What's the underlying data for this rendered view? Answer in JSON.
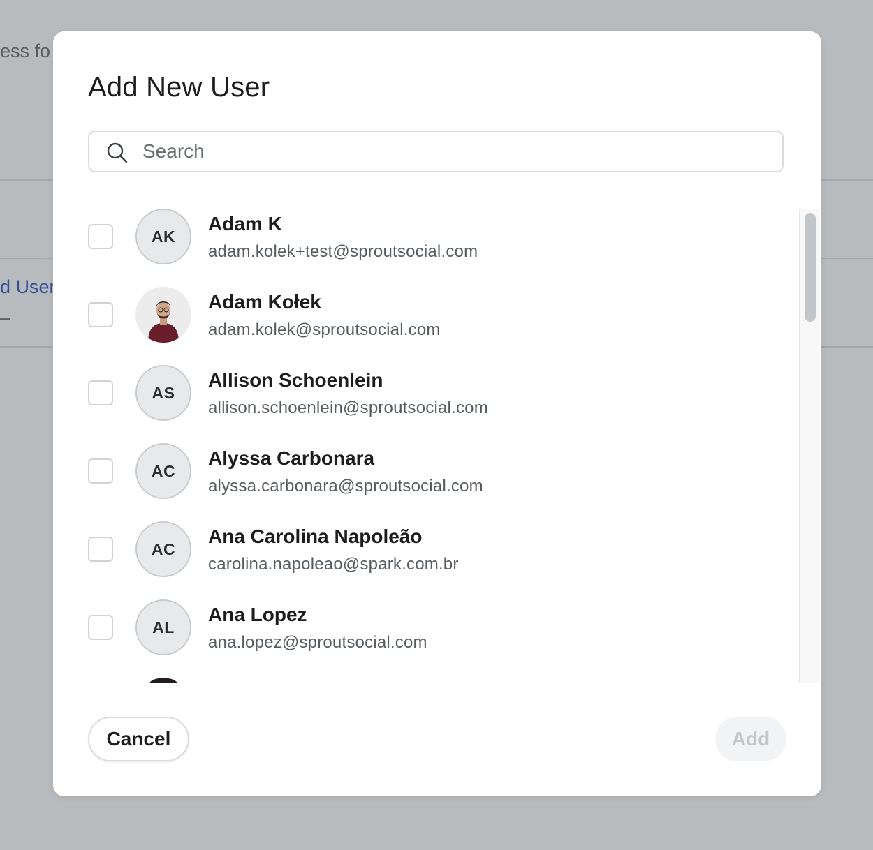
{
  "background": {
    "fragment_1": "ess fo",
    "fragment_2": "d User",
    "fragment_3": "–"
  },
  "modal": {
    "title": "Add New User",
    "search": {
      "placeholder": "Search",
      "value": ""
    },
    "users": [
      {
        "name": "Adam K",
        "email": "adam.kolek+test@sproutsocial.com",
        "initials": "AK",
        "avatar": "initials",
        "checked": false
      },
      {
        "name": "Adam Kołek",
        "email": "adam.kolek@sproutsocial.com",
        "initials": "",
        "avatar": "photo",
        "checked": false
      },
      {
        "name": "Allison Schoenlein",
        "email": "allison.schoenlein@sproutsocial.com",
        "initials": "AS",
        "avatar": "initials",
        "checked": false
      },
      {
        "name": "Alyssa Carbonara",
        "email": "alyssa.carbonara@sproutsocial.com",
        "initials": "AC",
        "avatar": "initials",
        "checked": false
      },
      {
        "name": "Ana Carolina Napoleão",
        "email": "carolina.napoleao@spark.com.br",
        "initials": "AC",
        "avatar": "initials",
        "checked": false
      },
      {
        "name": "Ana Lopez",
        "email": "ana.lopez@sproutsocial.com",
        "initials": "AL",
        "avatar": "initials",
        "checked": false
      }
    ],
    "cancel_label": "Cancel",
    "add_label": "Add",
    "add_enabled": false
  },
  "colors": {
    "overlay": "#b8bbbd",
    "link": "#2f4f97",
    "disabled_text": "#c4c7c9"
  },
  "icons": {
    "search": "search-icon",
    "checkbox": "checkbox-icon",
    "avatar_photo": "person-photo-icon"
  }
}
